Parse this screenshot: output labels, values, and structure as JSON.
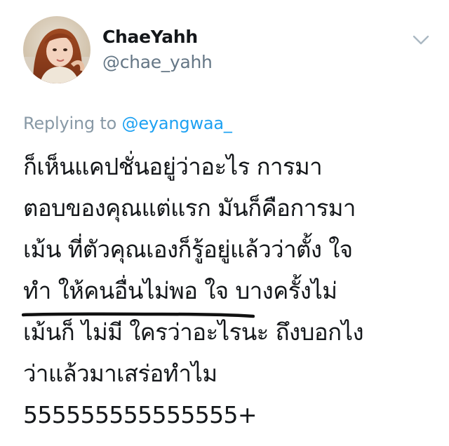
{
  "user": {
    "display_name": "ChaeYahh",
    "handle": "@chae_yahh",
    "avatar": "profile-photo"
  },
  "menu": {
    "icon": "chevron-down-icon"
  },
  "reply": {
    "prefix": "Replying to",
    "mention": "@eyangwaa_"
  },
  "tweet": {
    "lines": [
      "ก็เห็นแคปชั่นอยู่ว่าอะไร การมา",
      "ตอบของคุณแต่แรก มันก็คือการมา",
      "เม้น ที่ตัวคุณเองก็รู้อยู่แล้วว่าตั้ง ใจ",
      "ทำ ให้คนอื่นไม่พอ ใจ บางครั้งไม่",
      "เม้นก็ ไม่มี ใครว่าอะไรนะ ถึงบอกไง",
      "ว่าแล้วมาเสร่อทำไม",
      "555555555555555+"
    ]
  },
  "colors": {
    "text": "#14171a",
    "muted": "#657786",
    "reply_muted": "#8899a6",
    "link": "#1da1f2",
    "chevron": "#aab8c2",
    "pen_underline": "#111111"
  }
}
